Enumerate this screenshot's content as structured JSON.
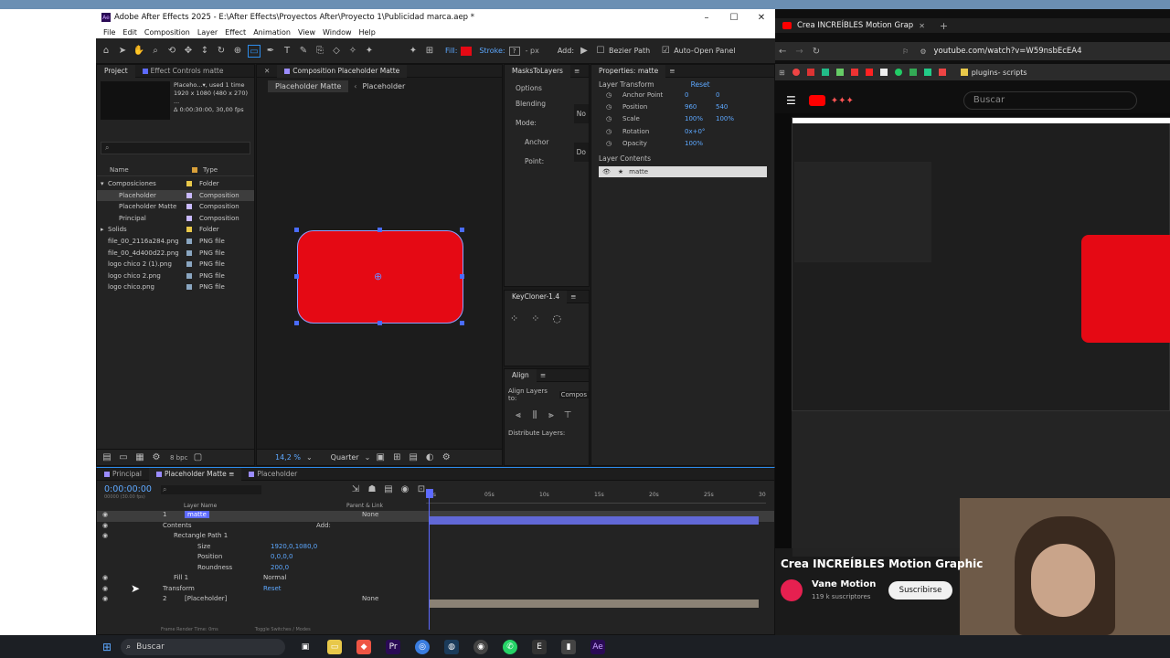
{
  "ae": {
    "title": "Adobe After Effects 2025 - E:\\After Effects\\Proyectos After\\Proyecto 1\\Publicidad marca.aep *",
    "menu": [
      "File",
      "Edit",
      "Composition",
      "Layer",
      "Effect",
      "Animation",
      "View",
      "Window",
      "Help"
    ],
    "toolbar": {
      "fill_label": "Fill:",
      "stroke_label": "Stroke:",
      "stroke_value": "- px",
      "add_label": "Add:",
      "bezier_label": "Bezier Path",
      "auto_open_label": "Auto-Open Panel",
      "fill_color": "#e50914"
    },
    "project": {
      "tab": "Project",
      "effects_tab": "Effect Controls matte",
      "info": [
        "Placeho...▾, used 1 time",
        "1920 x 1080 (480 x 270) ...",
        "Δ 0:00:30:00, 30,00 fps"
      ],
      "search_placeholder": "",
      "col_name": "Name",
      "col_type": "Type",
      "items": [
        {
          "name": "Composiciones",
          "type": "Folder",
          "color": "#e8c84a",
          "indent": 0,
          "twirl": "▾"
        },
        {
          "name": "Placeholder",
          "type": "Composition",
          "color": "#c9b9ff",
          "indent": 1,
          "twirl": "",
          "selected": true
        },
        {
          "name": "Placeholder Matte",
          "type": "Composition",
          "color": "#c9b9ff",
          "indent": 1,
          "twirl": ""
        },
        {
          "name": "Principal",
          "type": "Composition",
          "color": "#c9b9ff",
          "indent": 1,
          "twirl": ""
        },
        {
          "name": "Solids",
          "type": "Folder",
          "color": "#e8c84a",
          "indent": 0,
          "twirl": "▸"
        },
        {
          "name": "file_00_2116a284.png",
          "type": "PNG file",
          "color": "#8aa6c1",
          "indent": 0,
          "twirl": ""
        },
        {
          "name": "file_00_4d400d22.png",
          "type": "PNG file",
          "color": "#8aa6c1",
          "indent": 0,
          "twirl": ""
        },
        {
          "name": "logo chico 2 (1).png",
          "type": "PNG file",
          "color": "#8aa6c1",
          "indent": 0,
          "twirl": ""
        },
        {
          "name": "logo chico 2.png",
          "type": "PNG file",
          "color": "#8aa6c1",
          "indent": 0,
          "twirl": ""
        },
        {
          "name": "logo chico.png",
          "type": "PNG file",
          "color": "#8aa6c1",
          "indent": 0,
          "twirl": ""
        }
      ],
      "bpc": "8 bpc"
    },
    "composition": {
      "tab": "Composition Placeholder Matte",
      "breadcrumb_1": "Placeholder Matte",
      "breadcrumb_2": "Placeholder",
      "zoom": "14,2 %",
      "quality": "Quarter",
      "shape_color": "#e50914"
    },
    "masks": {
      "tab": "MasksToLayers",
      "options": "Options",
      "blending": "Blending Mode:",
      "blending_val": "No",
      "anchor": "Anchor Point:",
      "anchor_val": "Do"
    },
    "keycloner": {
      "tab": "KeyCloner-1.4"
    },
    "align": {
      "tab": "Align",
      "align_to": "Align Layers to:",
      "align_to_val": "Compos",
      "distribute": "Distribute Layers:"
    },
    "properties": {
      "tab": "Properties: matte",
      "layer_transform": "Layer Transform",
      "reset": "Reset",
      "rows": [
        {
          "label": "Anchor Point",
          "v1": "0",
          "v2": "0"
        },
        {
          "label": "Position",
          "v1": "960",
          "v2": "540"
        },
        {
          "label": "Scale",
          "v1": "100%",
          "v2": "100%"
        },
        {
          "label": "Rotation",
          "v1": "0x+0°",
          "v2": ""
        },
        {
          "label": "Opacity",
          "v1": "100%",
          "v2": ""
        }
      ],
      "layer_contents": "Layer Contents",
      "content_item": "matte"
    },
    "timeline": {
      "tabs": [
        "Principal",
        "Placeholder Matte",
        "Placeholder"
      ],
      "timecode": "0:00:00:00",
      "timecode_sub": "00000 (30.00 fps)",
      "col_layer": "Layer Name",
      "col_parent": "Parent & Link",
      "ruler": [
        "0s",
        "05s",
        "10s",
        "15s",
        "20s",
        "25s",
        "30"
      ],
      "rows": [
        {
          "num": "1",
          "name": "matte",
          "parent": "None",
          "kind": "layer"
        },
        {
          "name": "Contents",
          "add": "Add:",
          "kind": "group"
        },
        {
          "name": "Rectangle Path 1",
          "kind": "sub"
        },
        {
          "name": "Size",
          "value": "1920,0,1080,0",
          "kind": "prop"
        },
        {
          "name": "Position",
          "value": "0,0,0,0",
          "kind": "prop"
        },
        {
          "name": "Roundness",
          "value": "200,0",
          "kind": "prop"
        },
        {
          "name": "Fill 1",
          "value": "Normal",
          "kind": "sub"
        },
        {
          "name": "Transform",
          "value": "Reset",
          "kind": "group"
        },
        {
          "num": "2",
          "name": "[Placeholder]",
          "parent": "None",
          "kind": "layer"
        }
      ],
      "footer": "Frame Render Time: 0ms",
      "footer_toggle": "Toggle Switches / Modes"
    }
  },
  "browser": {
    "tab_title": "Crea INCREÍBLES Motion Grap",
    "url": "youtube.com/watch?v=W59nsbEcEA4",
    "bookmark": "plugins- scripts",
    "search_placeholder": "Buscar",
    "video_title": "Crea INCREÍBLES Motion Graphic",
    "channel": "Vane Motion",
    "subs": "119 k suscriptores",
    "subscribe": "Suscribirse"
  },
  "taskbar": {
    "search": "Buscar"
  }
}
